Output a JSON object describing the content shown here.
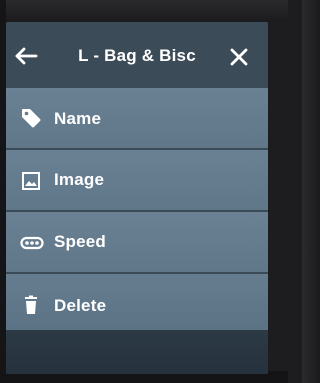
{
  "header": {
    "title": "L - Bag & Bisc",
    "back_icon": "arrow-left-icon",
    "close_icon": "close-icon"
  },
  "menu": {
    "items": [
      {
        "label": "Name",
        "icon": "tag-icon"
      },
      {
        "label": "Image",
        "icon": "image-icon"
      },
      {
        "label": "Speed",
        "icon": "speed-icon"
      },
      {
        "label": "Delete",
        "icon": "trash-icon"
      }
    ]
  },
  "colors": {
    "header_bg": "#3c4b58",
    "item_bg": "#6a8194",
    "text": "#ffffff"
  }
}
